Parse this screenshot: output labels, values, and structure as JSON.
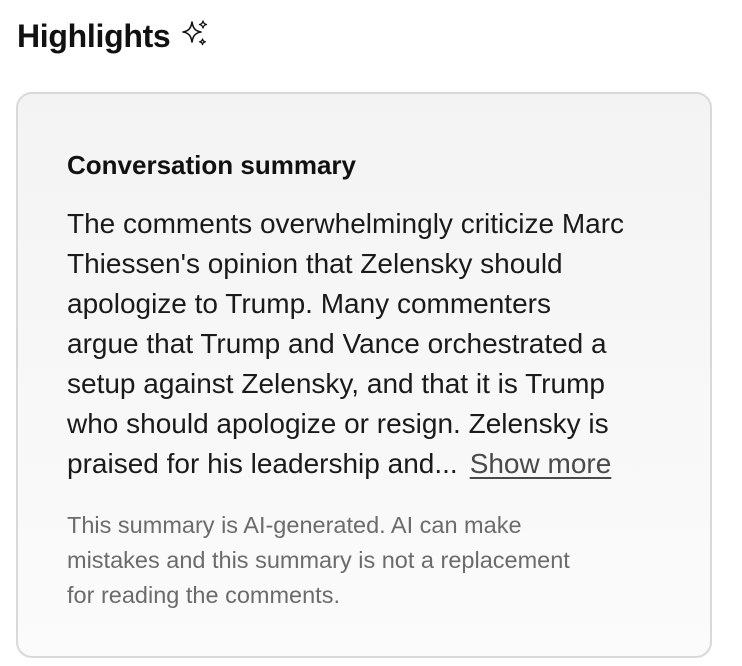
{
  "header": {
    "title": "Highlights",
    "icon": "sparkle-icon"
  },
  "card": {
    "title": "Conversation summary",
    "summary_lines": [
      "The comments overwhelmingly criticize Marc",
      "Thiessen's opinion that Zelensky should",
      "apologize to Trump. Many commenters",
      "argue that Trump and Vance orchestrated a",
      "setup against Zelensky, and that it is Trump",
      "who should apologize or resign. Zelensky is",
      "praised for his leadership and..."
    ],
    "show_more_label": "Show more",
    "disclaimer_lines": [
      "This summary is AI-generated. AI can make",
      "mistakes and this summary is not a replacement",
      "for reading the comments."
    ]
  },
  "colors": {
    "text": "#111111",
    "muted": "#6b6b6b",
    "card_border": "#d9d9d9",
    "card_background": "#f5f5f5"
  }
}
